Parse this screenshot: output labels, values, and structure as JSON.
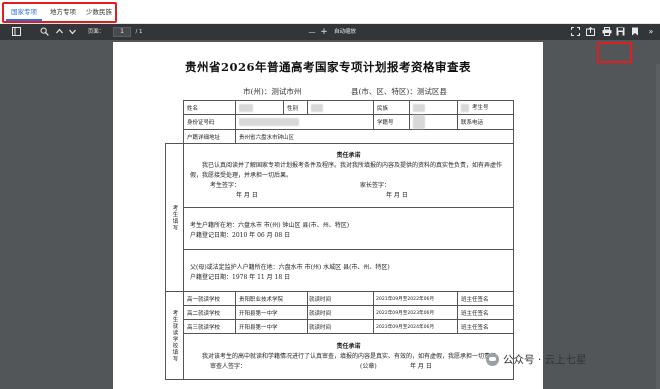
{
  "tabs": [
    {
      "label": "国家专项",
      "active": true
    },
    {
      "label": "地方专项",
      "active": false
    },
    {
      "label": "少数民族",
      "active": false
    }
  ],
  "toolbar": {
    "page_label": "页面：",
    "page_value": "1",
    "page_total": "/ 1",
    "zoom_label": "自动缩放",
    "zoom_minus": "—",
    "zoom_plus": "+"
  },
  "doc": {
    "title": "贵州省2026年普通高考国家专项计划报考资格审查表",
    "city": "市(州)：测试市州",
    "county": "县(市、区、特区)：测试区县",
    "row1": {
      "name_label": "姓名",
      "gender_label": "性别",
      "ethnic_label": "民族",
      "exam_no_label": "考生号"
    },
    "row2": {
      "id_label": "身份证号码",
      "school_no_label": "学籍号",
      "phone_label": "联系电话"
    },
    "row3": {
      "address_label": "户籍详细地址",
      "address_value": "贵州省六盘水市钟山区"
    },
    "side_label_student": "考生填写",
    "side_label_school": "考生就读学校填写",
    "commit1": {
      "heading": "责任承诺",
      "text": "我已认真阅读并了解国家专项计划报考条件及程序。我对我所填报的内容及提供的资料的真实性负责，如有弄虚作假，我愿接受处理，并承担一切后果。",
      "student_sign": "考生签字：",
      "parent_sign": "家长签字：",
      "date": "年    月    日",
      "date2": "年    月    日"
    },
    "household": {
      "line1": "考生户籍所在地：六盘水市 市(州) 钟山区 县(市、州、特区)",
      "line2": "户籍登记日期：2010 年 06 月 08 日"
    },
    "parent_household": {
      "line1": "父(母)或法定监护人户籍所在地：六盘水市 市(州) 水城区 县(市、州、特区)",
      "line2": "户籍登记日期：1978 年 11 月 18 日"
    },
    "schools": [
      {
        "label": "高一就读学校",
        "school": "贵阳职业技术学院",
        "time_label": "就读时间",
        "time": "2021年09月至2022年06月",
        "class_label": "班主任签名"
      },
      {
        "label": "高二就读学校",
        "school": "开阳县第一中学",
        "time_label": "就读时间",
        "time": "2022年09月至2023年06月",
        "class_label": "班主任签名"
      },
      {
        "label": "高三就读学校",
        "school": "开阳县第一中学",
        "time_label": "就读时间",
        "time": "2023年09月至2024年06月",
        "class_label": "班主任签名"
      }
    ],
    "commit2": {
      "heading": "责任承诺",
      "text": "我对该考生的高中就读和学籍情况进行了认真审查，填报的内容是真实、有效的，如有虚假，我愿承担一切责任。",
      "reviewer": "审查人签字：",
      "seal": "(公章)",
      "date": "年    月    日"
    }
  },
  "watermark": "公众号 · 云上七星"
}
